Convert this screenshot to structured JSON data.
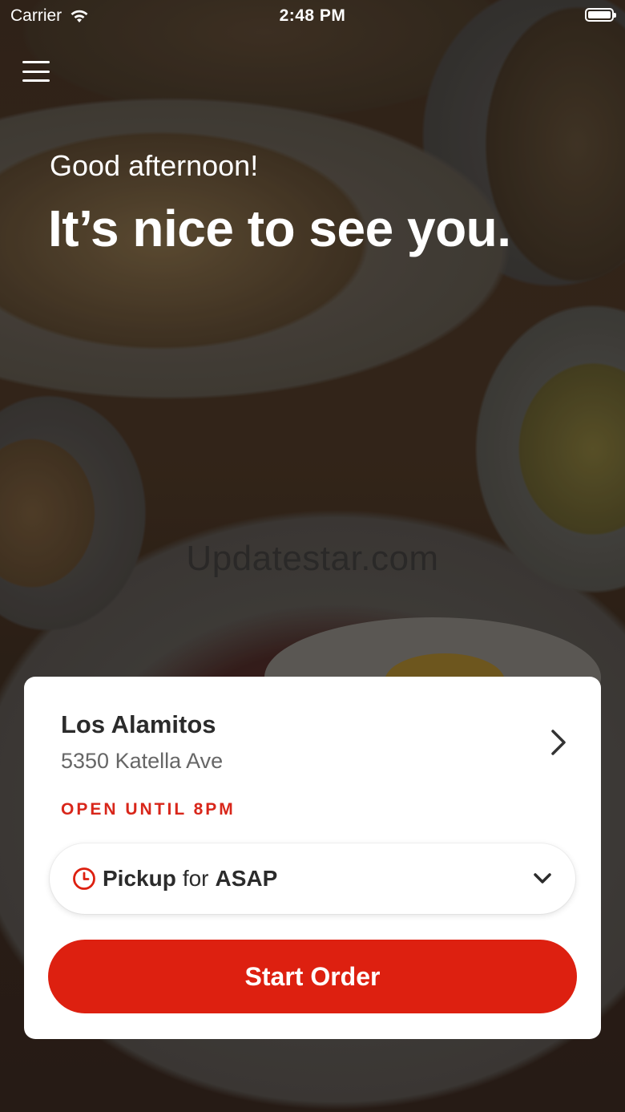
{
  "status_bar": {
    "carrier": "Carrier",
    "time": "2:48 PM",
    "wifi_icon": "wifi-icon",
    "battery_icon": "battery-icon"
  },
  "header": {
    "menu_icon": "hamburger-menu-icon",
    "greeting": "Good afternoon!",
    "headline": "It’s nice to see you."
  },
  "watermark": "Updatestar.com",
  "location_card": {
    "name": "Los Alamitos",
    "address": "5350 Katella Ave",
    "open_status": "OPEN UNTIL 8PM",
    "chevron_icon": "chevron-right-icon",
    "order_type": {
      "clock_icon": "clock-icon",
      "mode": "Pickup",
      "connector": "for",
      "time": "ASAP",
      "dropdown_icon": "chevron-down-icon"
    },
    "start_button_label": "Start Order"
  },
  "colors": {
    "accent": "#dd2010",
    "status_text": "#d8261a",
    "card_background": "#ffffff"
  }
}
